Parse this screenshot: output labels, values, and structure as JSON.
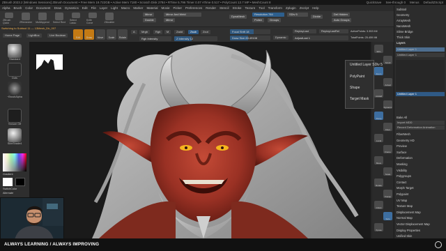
{
  "window": {
    "title": "ZBrush 2023.2 [Windows Sessions]  ZBrush Document   • Free Mem 19.722GB • Active Mem 7180 • Scratch Disk 2784 • RTime 5.796 Timer 0.07 ATime 0.517 • PolyCount 13.7 MP • MeshCount 8",
    "quicksave": "QuickSave",
    "see_through": "See-through  0",
    "menus": "Menus",
    "default_script": "DefaultZScript"
  },
  "menubar": [
    "Alpha",
    "Brush",
    "Color",
    "Document",
    "Draw",
    "Dynamics",
    "Edit",
    "File",
    "Layer",
    "Light",
    "Macro",
    "Marker",
    "Material",
    "Movie",
    "Picker",
    "Preferences",
    "Render",
    "Stencil",
    "Stroke",
    "Texture",
    "Tool",
    "Transform",
    "Zplugin",
    "Zscript",
    "Help"
  ],
  "shelf": {
    "buttons": [
      "ZBrush Quick",
      "ZRemesher",
      "MultiAppend",
      "Select Rect",
      "Select Lasso",
      "Knife Curve",
      "ZModeler"
    ],
    "mirror": "Mirror",
    "mirror_weld": "Mirror And Weld",
    "double": "Double",
    "mirror2": "Mirror",
    "dynamesh": "DynaMesh",
    "resolution": "Resolution 784",
    "sdiv": "SDiv 5",
    "divide": "Divide",
    "del_hidden": "Del Hidden",
    "polish": "Polish",
    "groups": "Groups",
    "auto_groups": "Auto Groups",
    "zremesher": "ZRemesher",
    "dynamesh_label": "Dynamic"
  },
  "subtool_notice": "Switching to Subtool 11 — 13Mesh_Dir_007",
  "toolbar2": {
    "home_page": "Home Page",
    "lightbox": "LightBox",
    "live_boolean": "Live Boolean",
    "edit": "Edit",
    "draw": "Draw",
    "move": "Move",
    "scale": "Scale",
    "rotate": "Rotate",
    "a": "A",
    "mrgb": "Mrgb",
    "rgb": "Rgb",
    "m": "M",
    "zadd": "Zadd",
    "zsub": "Zsub",
    "zcut": "Zcut",
    "focal_shift": "Focal Shift 18",
    "draw_size": "Draw Size 83.49108",
    "z_intensity": "Z Intensity 12",
    "dynamic": "Dynamic",
    "rgb_intensity": "Rgb Intensity",
    "replay_last": "ReplayLast",
    "replay_last_rel": "ReplayLastRel",
    "active_points": "ActivePoints: 3.353 Mil",
    "total_points": "TotalPoints: 25.459 Mil",
    "adjust_last": "AdjustLast 1"
  },
  "left_panel": {
    "standard": "Standard",
    "dots": "Dots",
    "brush_alpha": "~BrushAlpha",
    "texture_off": "Texture Off",
    "skin_shade": "SkinShade4",
    "gradient": "Gradient",
    "switch_color": "SwitchColor",
    "alternate": "Alternate"
  },
  "popup": {
    "items": [
      "Untitled Layer SDiv 5",
      "PolyPaint",
      "Shape",
      "Target Mask"
    ]
  },
  "right_panel": {
    "subtool_items": [
      "Subtool",
      "Geometry",
      "ArrayMesh",
      "NanoMesh",
      "Slime Bridge",
      "Thick Skin",
      "Layers"
    ],
    "layer_rows": [
      "Untitled Layer 1",
      "Untitled Layer 1"
    ],
    "layer_selected": "Untitled Layer 1",
    "bake_all": "Bake All",
    "import_mdd": "Import MDD",
    "speed": "Speed",
    "record": "Record Deformation Animation",
    "lower_items": [
      "FiberMesh",
      "Geometry HD",
      "Preview",
      "Surface",
      "Deformation",
      "Masking",
      "Visibility",
      "Polygroups",
      "Contact",
      "Morph Target",
      "Polypaint",
      "UV Map",
      "Texture Map",
      "Displacement Map",
      "Normal Map",
      "Vector Displacement Map",
      "Display Properties",
      "Unified Skin",
      "Initialize"
    ]
  },
  "right_toolbar": [
    "SPix",
    "Scroll",
    "Zoom",
    "Actual",
    "AAHalf",
    "Dynamic",
    "Persp",
    "Floor",
    "Local",
    "Frame",
    "Move",
    "Scale",
    "Rotate",
    "Transp",
    "Ghost",
    "Solo",
    "Xpose"
  ],
  "bottom_bar": {
    "text": "ALWAYS LEARNING  /  ALWAYS IMPROVING"
  },
  "colors": {
    "accent_orange": "#c47a14",
    "accent_blue": "#2f5a86",
    "skin_red": "#a83a2c",
    "horn_gray": "#b8b8b8"
  }
}
